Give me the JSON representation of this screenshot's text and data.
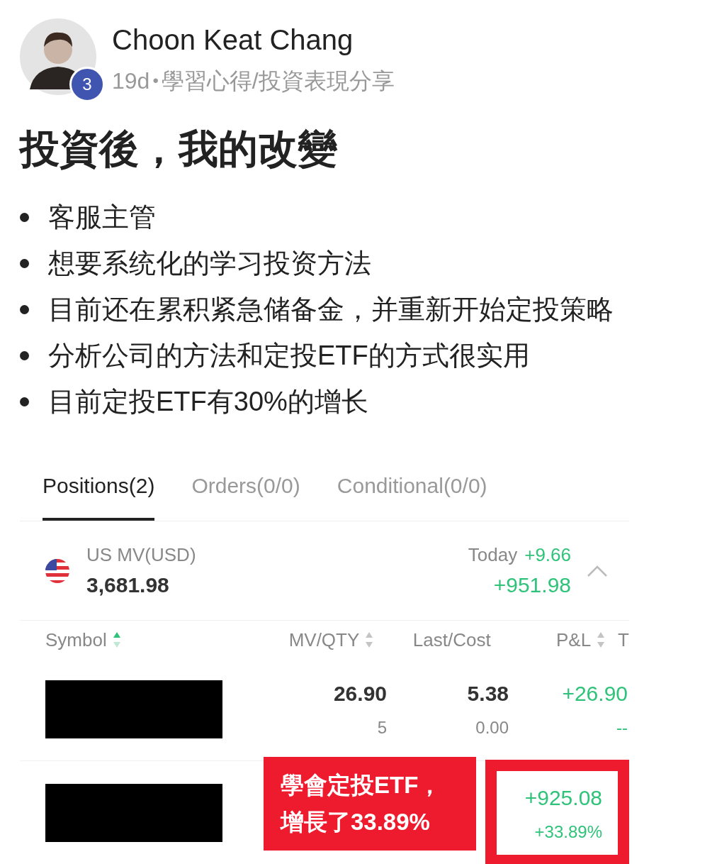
{
  "post": {
    "author": "Choon Keat Chang",
    "level_badge": "3",
    "age": "19d",
    "separator": "•",
    "category": "學習心得/投資表現分享",
    "title": "投資後，我的改變",
    "bullets": [
      "客服主管",
      "想要系统化的学习投资方法",
      "目前还在累积紧急储备金，并重新开始定投策略",
      "分析公司的方法和定投ETF的方式很实用",
      "目前定投ETF有30%的增长"
    ]
  },
  "broker": {
    "tabs": [
      {
        "label": "Positions(2)",
        "selected": true
      },
      {
        "label": "Orders(0/0)",
        "selected": false
      },
      {
        "label": "Conditional(0/0)",
        "selected": false
      }
    ],
    "summary": {
      "label": "US MV(USD)",
      "value": "3,681.98",
      "today_label": "Today",
      "today_value": "+9.66",
      "total_pl": "+951.98",
      "expanded": true
    },
    "columns": [
      {
        "label": "Symbol",
        "sort_active": true
      },
      {
        "label": "MV/QTY",
        "sort_active": false
      },
      {
        "label": "Last/Cost"
      },
      {
        "label": "P&L",
        "sort_active": false
      },
      {
        "label": "T"
      }
    ],
    "rows": [
      {
        "redacted": true,
        "mv": "26.90",
        "qty": "5",
        "last": "5.38",
        "cost": "0.00",
        "pl": "+26.90",
        "pl_pct": "--",
        "highlighted": false
      },
      {
        "redacted": true,
        "pl": "+925.08",
        "pl_pct": "+33.89%",
        "highlighted": true
      }
    ]
  },
  "callout": {
    "lines": [
      "學會定投ETF，",
      "增長了33.89%"
    ]
  }
}
